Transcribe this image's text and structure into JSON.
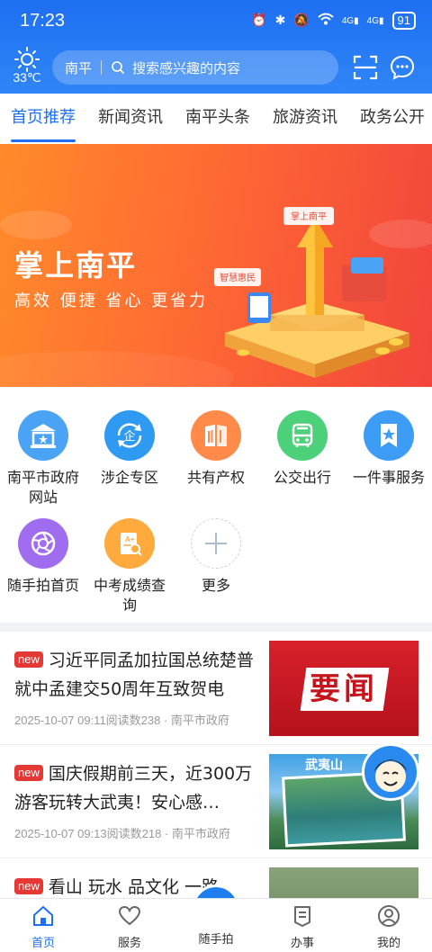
{
  "status": {
    "time": "17:23",
    "battery": "91",
    "net1": "4G",
    "net2": "4G"
  },
  "weather": {
    "temp": "33℃",
    "icon": "sun-icon"
  },
  "search": {
    "city": "南平",
    "placeholder": "搜索感兴趣的内容"
  },
  "tabs": [
    "首页推荐",
    "新闻资讯",
    "南平头条",
    "旅游资讯",
    "政务公开"
  ],
  "banner": {
    "title": "掌上南平",
    "subtitle": "高效 便捷 省心 更省力",
    "tag1": "掌上南平",
    "tag2": "智慧惠民"
  },
  "services": [
    {
      "label": "南平市政府网站",
      "icon": "government-building-icon",
      "color": "#4aa3f5"
    },
    {
      "label": "涉企专区",
      "icon": "enterprise-refresh-icon",
      "color": "#2f9af2"
    },
    {
      "label": "共有产权",
      "icon": "book-building-icon",
      "color": "#ff8a4a"
    },
    {
      "label": "公交出行",
      "icon": "bus-icon",
      "color": "#4cd07a"
    },
    {
      "label": "一件事服务",
      "icon": "bookmark-star-icon",
      "color": "#3d9cf5"
    },
    {
      "label": "随手拍首页",
      "icon": "camera-aperture-icon",
      "color": "#a06df0"
    },
    {
      "label": "中考成绩查询",
      "icon": "exam-search-icon",
      "color": "#ffaa3c"
    },
    {
      "label": "更多",
      "icon": "plus-icon",
      "color": "#c9d3de"
    }
  ],
  "news": [
    {
      "tag": "new",
      "title": "习近平同孟加拉国总统楚普就中孟建交50周年互致贺电",
      "meta": "2025-10-07 09:11阅读数238 · 南平市政府",
      "thumb_text": "要闻"
    },
    {
      "tag": "new",
      "title": "国庆假期前三天，近300万游客玩转大武夷！安心感…",
      "meta": "2025-10-07 09:13阅读数218 · 南平市政府",
      "thumb_text": "武夷山"
    },
    {
      "tag": "new",
      "title": "看山 玩水 品文化 一路",
      "meta": "",
      "thumb_text": ""
    }
  ],
  "bottom_nav": [
    {
      "label": "首页",
      "icon": "home-icon"
    },
    {
      "label": "服务",
      "icon": "heart-icon"
    },
    {
      "label": "随手拍",
      "icon": "camera-icon"
    },
    {
      "label": "办事",
      "icon": "document-icon"
    },
    {
      "label": "我的",
      "icon": "user-icon"
    }
  ],
  "colors": {
    "primary": "#1e6ff2",
    "new_tag": "#e53935",
    "banner": "#ff6a33"
  }
}
